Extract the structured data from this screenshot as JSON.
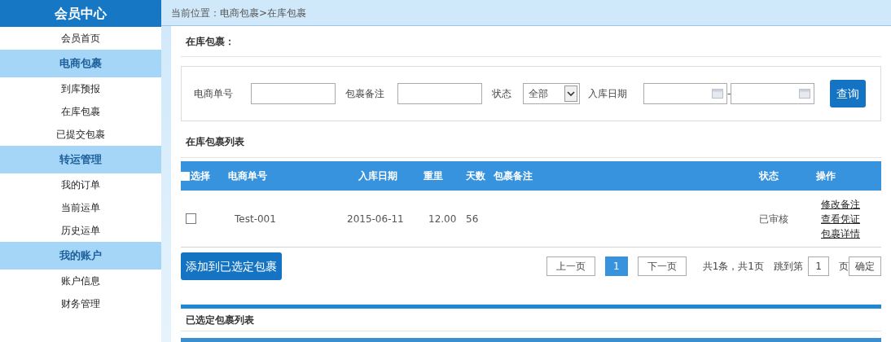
{
  "sidebar": {
    "title": "会员中心",
    "items": [
      {
        "kind": "link",
        "label": "会员首页"
      },
      {
        "kind": "group",
        "label": "电商包裹"
      },
      {
        "kind": "link",
        "label": "到库预报"
      },
      {
        "kind": "link",
        "label": "在库包裹"
      },
      {
        "kind": "link",
        "label": "已提交包裹"
      },
      {
        "kind": "group",
        "label": "转运管理"
      },
      {
        "kind": "link",
        "label": "我的订单"
      },
      {
        "kind": "link",
        "label": "当前运单"
      },
      {
        "kind": "link",
        "label": "历史运单"
      },
      {
        "kind": "group",
        "label": "我的账户"
      },
      {
        "kind": "link",
        "label": "账户信息"
      },
      {
        "kind": "link",
        "label": "财务管理"
      }
    ]
  },
  "breadcrumb": "当前位置：电商包裹>在库包裹",
  "section_title": "在库包裹：",
  "filters": {
    "order_label": "电商单号",
    "note_label": "包裹备注",
    "status_label": "状态",
    "status_value": "全部",
    "date_label": "入库日期",
    "date_separator": "-",
    "search_button": "查询"
  },
  "list_title": "在库包裹列表",
  "table": {
    "select_all_checked": false,
    "columns": [
      "选择",
      "电商单号",
      "入库日期",
      "重里",
      "天数",
      "包裹备注",
      "状态",
      "操作"
    ],
    "rows": [
      {
        "checked": false,
        "order_no": "Test-001",
        "date": "2015-06-11",
        "weight": "12.00",
        "days": "56",
        "note": "",
        "status": "已审核",
        "actions": [
          "修改备注",
          "查看凭证",
          "包裹详情"
        ]
      }
    ]
  },
  "add_button": "添加到已选定包裹",
  "pagination": {
    "prev": "上一页",
    "pages": [
      {
        "label": "1",
        "selected": true
      }
    ],
    "next": "下一页",
    "summary": "共1条，共1页",
    "jump_label": "跳到第",
    "jump_value": "1",
    "page_suffix": "页",
    "confirm": "确定"
  },
  "selected_title": "已选定包裹列表"
}
